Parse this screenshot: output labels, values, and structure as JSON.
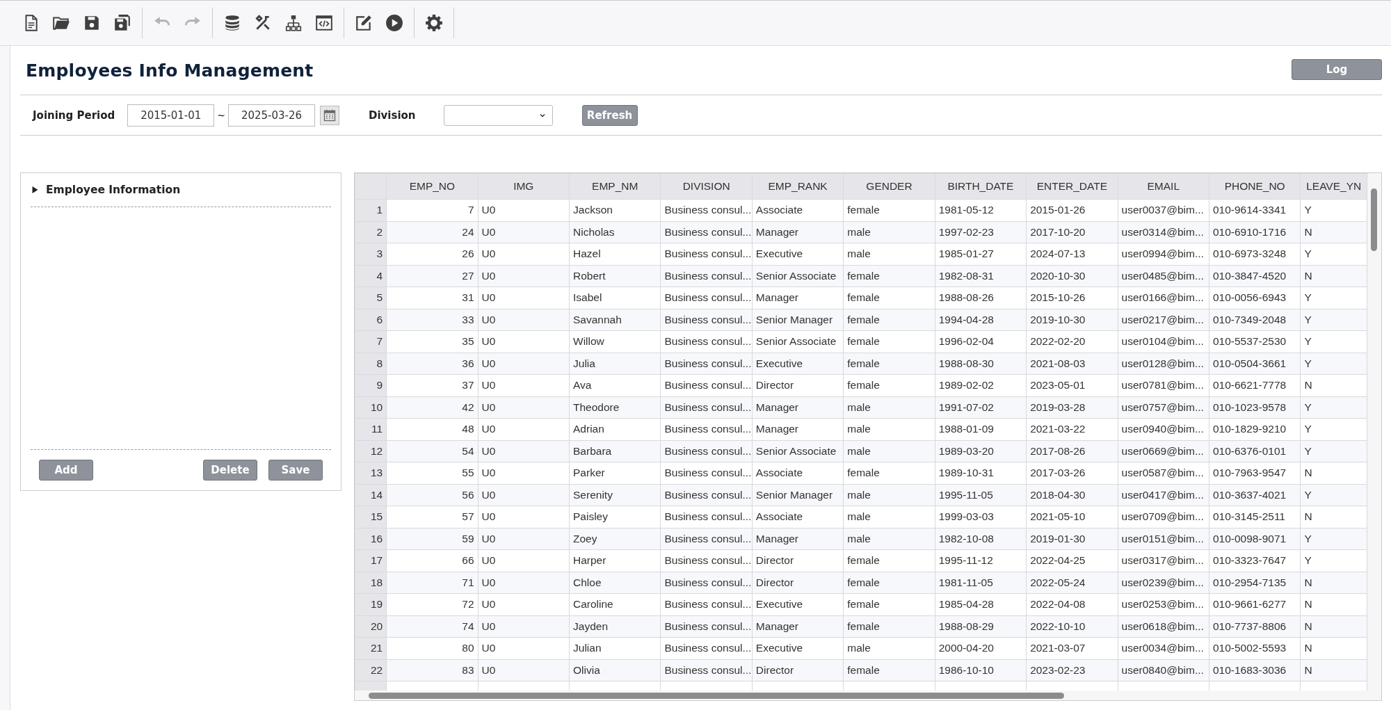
{
  "toolbar": [
    [
      {
        "disabled": false
      },
      {
        "disabled": false
      },
      {
        "disabled": false
      },
      {
        "disabled": false
      }
    ],
    [
      {
        "disabled": true
      },
      {
        "disabled": true
      }
    ],
    [
      {
        "disabled": false
      },
      {
        "disabled": false
      },
      {
        "disabled": false
      },
      {
        "disabled": false
      }
    ],
    [
      {
        "disabled": false
      },
      {
        "disabled": false
      }
    ],
    [
      {
        "disabled": false
      }
    ]
  ],
  "page_title": "Employees Info Management",
  "log_button": "Log",
  "filters": {
    "joining_period_label": "Joining Period",
    "date_from": "2015-01-01",
    "separator": "~",
    "date_to": "2025-03-26",
    "division_label": "Division",
    "refresh_button": "Refresh"
  },
  "side_panel": {
    "title": "Employee Information",
    "expanded": false,
    "buttons": [
      "Add",
      "Delete",
      "Save"
    ]
  },
  "table": {
    "columns": [
      "EMP_NO",
      "IMG",
      "EMP_NM",
      "DIVISION",
      "EMP_RANK",
      "GENDER",
      "BIRTH_DATE",
      "ENTER_DATE",
      "EMAIL",
      "PHONE_NO",
      "LEAVE_YN"
    ],
    "rows": [
      {
        "number": "1",
        "cells": [
          "7",
          "U0",
          "Jackson",
          "Business consul...",
          "Associate",
          "female",
          "1981-05-12",
          "2015-01-26",
          "user0037@bim...",
          "010-9614-3341",
          "Y"
        ]
      },
      {
        "number": "2",
        "cells": [
          "24",
          "U0",
          "Nicholas",
          "Business consul...",
          "Manager",
          "male",
          "1997-02-23",
          "2017-10-20",
          "user0314@bim...",
          "010-6910-1716",
          "N"
        ]
      },
      {
        "number": "3",
        "cells": [
          "26",
          "U0",
          "Hazel",
          "Business consul...",
          "Executive",
          "male",
          "1985-01-27",
          "2024-07-13",
          "user0994@bim...",
          "010-6973-3248",
          "Y"
        ]
      },
      {
        "number": "4",
        "cells": [
          "27",
          "U0",
          "Robert",
          "Business consul...",
          "Senior Associate",
          "female",
          "1982-08-31",
          "2020-10-30",
          "user0485@bim...",
          "010-3847-4520",
          "N"
        ]
      },
      {
        "number": "5",
        "cells": [
          "31",
          "U0",
          "Isabel",
          "Business consul...",
          "Manager",
          "female",
          "1988-08-26",
          "2015-10-26",
          "user0166@bim...",
          "010-0056-6943",
          "Y"
        ]
      },
      {
        "number": "6",
        "cells": [
          "33",
          "U0",
          "Savannah",
          "Business consul...",
          "Senior Manager",
          "female",
          "1994-04-28",
          "2019-10-30",
          "user0217@bim...",
          "010-7349-2048",
          "Y"
        ]
      },
      {
        "number": "7",
        "cells": [
          "35",
          "U0",
          "Willow",
          "Business consul...",
          "Senior Associate",
          "female",
          "1996-02-04",
          "2022-02-20",
          "user0104@bim...",
          "010-5537-2530",
          "Y"
        ]
      },
      {
        "number": "8",
        "cells": [
          "36",
          "U0",
          "Julia",
          "Business consul...",
          "Executive",
          "female",
          "1988-08-30",
          "2021-08-03",
          "user0128@bim...",
          "010-0504-3661",
          "Y"
        ]
      },
      {
        "number": "9",
        "cells": [
          "37",
          "U0",
          "Ava",
          "Business consul...",
          "Director",
          "female",
          "1989-02-02",
          "2023-05-01",
          "user0781@bim...",
          "010-6621-7778",
          "N"
        ]
      },
      {
        "number": "10",
        "cells": [
          "42",
          "U0",
          "Theodore",
          "Business consul...",
          "Manager",
          "male",
          "1991-07-02",
          "2019-03-28",
          "user0757@bim...",
          "010-1023-9578",
          "Y"
        ]
      },
      {
        "number": "11",
        "cells": [
          "48",
          "U0",
          "Adrian",
          "Business consul...",
          "Manager",
          "male",
          "1988-01-09",
          "2021-03-22",
          "user0940@bim...",
          "010-1829-9210",
          "Y"
        ]
      },
      {
        "number": "12",
        "cells": [
          "54",
          "U0",
          "Barbara",
          "Business consul...",
          "Senior Associate",
          "male",
          "1989-03-20",
          "2017-08-26",
          "user0669@bim...",
          "010-6376-0101",
          "Y"
        ]
      },
      {
        "number": "13",
        "cells": [
          "55",
          "U0",
          "Parker",
          "Business consul...",
          "Associate",
          "female",
          "1989-10-31",
          "2017-03-26",
          "user0587@bim...",
          "010-7963-9547",
          "N"
        ]
      },
      {
        "number": "14",
        "cells": [
          "56",
          "U0",
          "Serenity",
          "Business consul...",
          "Senior Manager",
          "male",
          "1995-11-05",
          "2018-04-30",
          "user0417@bim...",
          "010-3637-4021",
          "Y"
        ]
      },
      {
        "number": "15",
        "cells": [
          "57",
          "U0",
          "Paisley",
          "Business consul...",
          "Associate",
          "male",
          "1999-03-03",
          "2021-05-10",
          "user0709@bim...",
          "010-3145-2511",
          "N"
        ]
      },
      {
        "number": "16",
        "cells": [
          "59",
          "U0",
          "Zoey",
          "Business consul...",
          "Manager",
          "male",
          "1982-10-08",
          "2019-01-30",
          "user0151@bim...",
          "010-0098-9071",
          "Y"
        ]
      },
      {
        "number": "17",
        "cells": [
          "66",
          "U0",
          "Harper",
          "Business consul...",
          "Director",
          "female",
          "1995-11-12",
          "2022-04-25",
          "user0317@bim...",
          "010-3323-7647",
          "Y"
        ]
      },
      {
        "number": "18",
        "cells": [
          "71",
          "U0",
          "Chloe",
          "Business consul...",
          "Director",
          "female",
          "1981-11-05",
          "2022-05-24",
          "user0239@bim...",
          "010-2954-7135",
          "N"
        ]
      },
      {
        "number": "19",
        "cells": [
          "72",
          "U0",
          "Caroline",
          "Business consul...",
          "Executive",
          "female",
          "1985-04-28",
          "2022-04-08",
          "user0253@bim...",
          "010-9661-6277",
          "N"
        ]
      },
      {
        "number": "20",
        "cells": [
          "74",
          "U0",
          "Jayden",
          "Business consul...",
          "Manager",
          "female",
          "1988-08-29",
          "2022-10-10",
          "user0618@bim...",
          "010-7737-8806",
          "N"
        ]
      },
      {
        "number": "21",
        "cells": [
          "80",
          "U0",
          "Julian",
          "Business consul...",
          "Executive",
          "male",
          "2000-04-20",
          "2021-03-07",
          "user0034@bim...",
          "010-5002-5593",
          "N"
        ]
      },
      {
        "number": "22",
        "cells": [
          "83",
          "U0",
          "Olivia",
          "Business consul...",
          "Director",
          "female",
          "1986-10-10",
          "2023-02-23",
          "user0840@bim...",
          "010-1683-3036",
          "N"
        ]
      }
    ]
  }
}
